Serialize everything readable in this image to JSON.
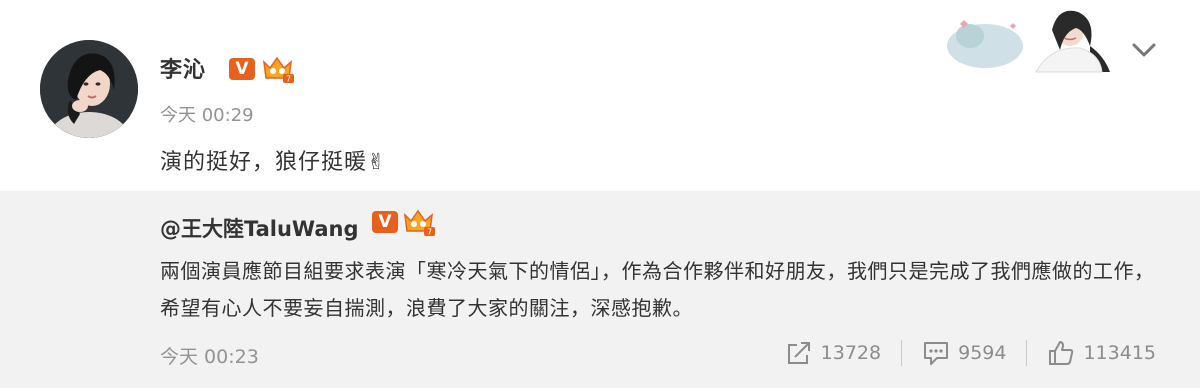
{
  "post": {
    "author": "李沁",
    "verified_mark": "V",
    "time": "今天 00:29",
    "content": "演的挺好，狼仔挺暖✌"
  },
  "repost": {
    "author": "@王大陸TaluWang",
    "verified_mark": "V",
    "text": "兩個演員應節目組要求表演「寒冷天氣下的情侶」，作為合作夥伴和好朋友，我們只是完成了我們應做的工作，希望有心人不要妄自揣測，浪費了大家的關注，深感抱歉。",
    "time": "今天 00:23",
    "share_count": "13728",
    "comment_count": "9594",
    "like_count": "113415"
  },
  "icons": [
    "avatar-photo",
    "verified-v-icon",
    "crown-badge-icon",
    "chevron-down-icon",
    "share-icon",
    "comment-icon",
    "like-icon"
  ],
  "colors": {
    "accent": "#e8601c",
    "repost_bg": "#f2f2f2",
    "meta_text": "#939393"
  }
}
